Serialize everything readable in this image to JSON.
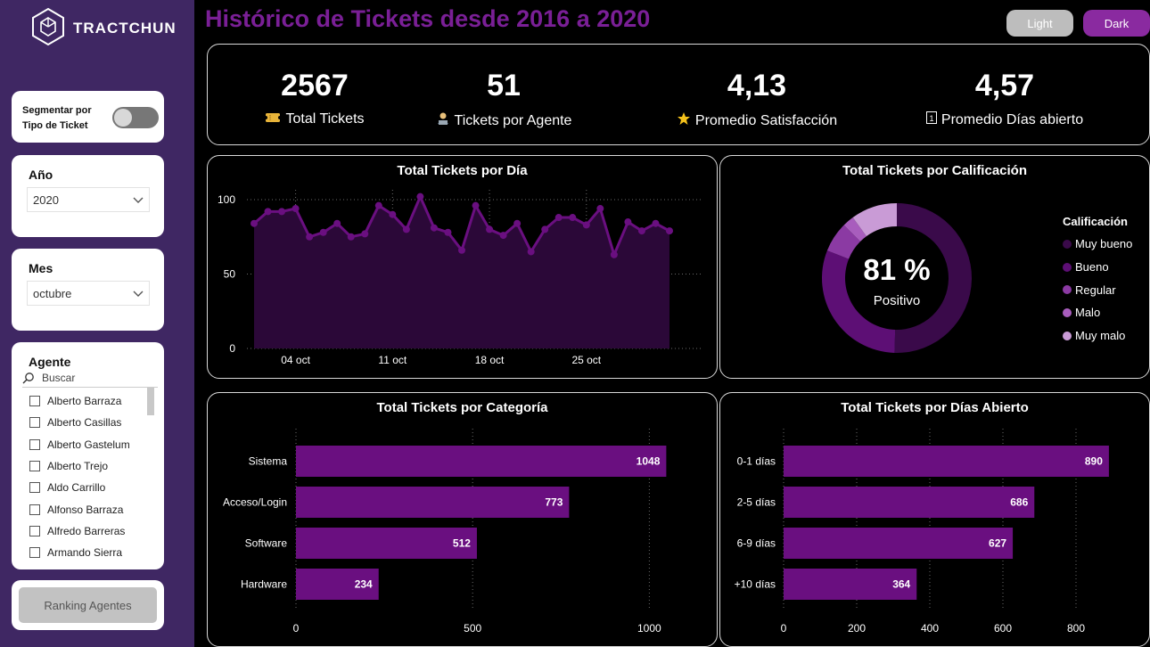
{
  "brand": {
    "name": "TRACTCHUN",
    "logo_icon": "hexagon-logo-icon"
  },
  "header": {
    "title": "Histórico de Tickets desde 2016 a 2020"
  },
  "theme_buttons": {
    "light": "Light",
    "dark": "Dark"
  },
  "sidebar": {
    "toggle_label_line1": "Segmentar por",
    "toggle_label_line2": "Tipo de Ticket",
    "year": {
      "label": "Año",
      "value": "2020"
    },
    "month": {
      "label": "Mes",
      "value": "octubre"
    },
    "agents": {
      "label": "Agente",
      "search_placeholder": "Buscar",
      "items": [
        "Alberto Barraza",
        "Alberto Casillas",
        "Alberto Gastelum",
        "Alberto Trejo",
        "Aldo Carrillo",
        "Alfonso Barraza",
        "Alfredo Barreras",
        "Armando Sierra"
      ]
    },
    "ranking_button": "Ranking Agentes"
  },
  "kpis": [
    {
      "value": "2567",
      "label": "Total Tickets",
      "icon": "ticket-icon"
    },
    {
      "value": "51",
      "label": "Tickets por Agente",
      "icon": "agent-icon"
    },
    {
      "value": "4,13",
      "label": "Promedio Satisfacción",
      "icon": "star-icon"
    },
    {
      "value": "4,57",
      "label": "Promedio Días abierto",
      "icon": "calendar-icon"
    }
  ],
  "colors": {
    "accent": "#7a1f96",
    "bar": "#6a0f80",
    "line": "#6a0f80",
    "area": "#2b0838",
    "ring_muy_bueno": "#3a0a4a",
    "ring_bueno": "#5d0f75",
    "ring_regular": "#8b3aa3",
    "ring_malo": "#a85dbd",
    "ring_muy_malo": "#c99bd6"
  },
  "chart_data": [
    {
      "type": "area",
      "title": "Total Tickets por Día",
      "x_tick_labels": [
        "04 oct",
        "11 oct",
        "18 oct",
        "25 oct"
      ],
      "x": [
        1,
        2,
        3,
        4,
        5,
        6,
        7,
        8,
        9,
        10,
        11,
        12,
        13,
        14,
        15,
        16,
        17,
        18,
        19,
        20,
        21,
        22,
        23,
        24,
        25,
        26,
        27,
        28,
        29,
        30,
        31
      ],
      "values": [
        84,
        92,
        92,
        94,
        75,
        78,
        84,
        75,
        77,
        96,
        90,
        80,
        102,
        81,
        78,
        66,
        96,
        80,
        76,
        84,
        65,
        80,
        88,
        88,
        83,
        94,
        63,
        85,
        79,
        84,
        79
      ],
      "ylim": [
        0,
        100
      ],
      "y_ticks": [
        0,
        50,
        100
      ],
      "grid": true
    },
    {
      "type": "pie",
      "title": "Total Tickets por Calificación",
      "center_value": "81 %",
      "center_label": "Positivo",
      "legend_title": "Calificación",
      "categories": [
        "Muy bueno",
        "Bueno",
        "Regular",
        "Malo",
        "Muy malo"
      ],
      "values": [
        50.5,
        30.5,
        6.5,
        2.5,
        10
      ]
    },
    {
      "type": "bar",
      "title": "Total Tickets por Categoría",
      "categories": [
        "Sistema",
        "Acceso/Login",
        "Software",
        "Hardware"
      ],
      "values": [
        1048,
        773,
        512,
        234
      ],
      "xlim": [
        0,
        1100
      ],
      "x_ticks": [
        0,
        500,
        1000
      ]
    },
    {
      "type": "bar",
      "title": "Total Tickets por Días Abierto",
      "categories": [
        "0-1 días",
        "2-5 días",
        "6-9 días",
        "+10 días"
      ],
      "values": [
        890,
        686,
        627,
        364
      ],
      "xlim": [
        0,
        900
      ],
      "x_ticks": [
        0,
        200,
        400,
        600,
        800
      ]
    }
  ]
}
